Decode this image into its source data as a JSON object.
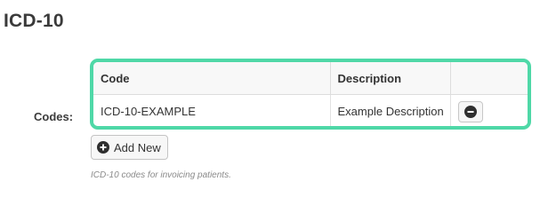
{
  "section": {
    "title": "ICD-10"
  },
  "field": {
    "label": "Codes:",
    "help_text": "ICD-10 codes for invoicing patients."
  },
  "table": {
    "columns": [
      {
        "label": "Code"
      },
      {
        "label": "Description"
      },
      {
        "label": ""
      }
    ],
    "rows": [
      {
        "code": "ICD-10-EXAMPLE",
        "description": "Example Description"
      }
    ]
  },
  "actions": {
    "add_new_label": "Add New"
  },
  "icons": {
    "remove": "minus-circle-icon",
    "add": "plus-circle-icon"
  },
  "colors": {
    "highlight_border": "#4fd8a7",
    "icon_fill": "#2f2f2f"
  }
}
